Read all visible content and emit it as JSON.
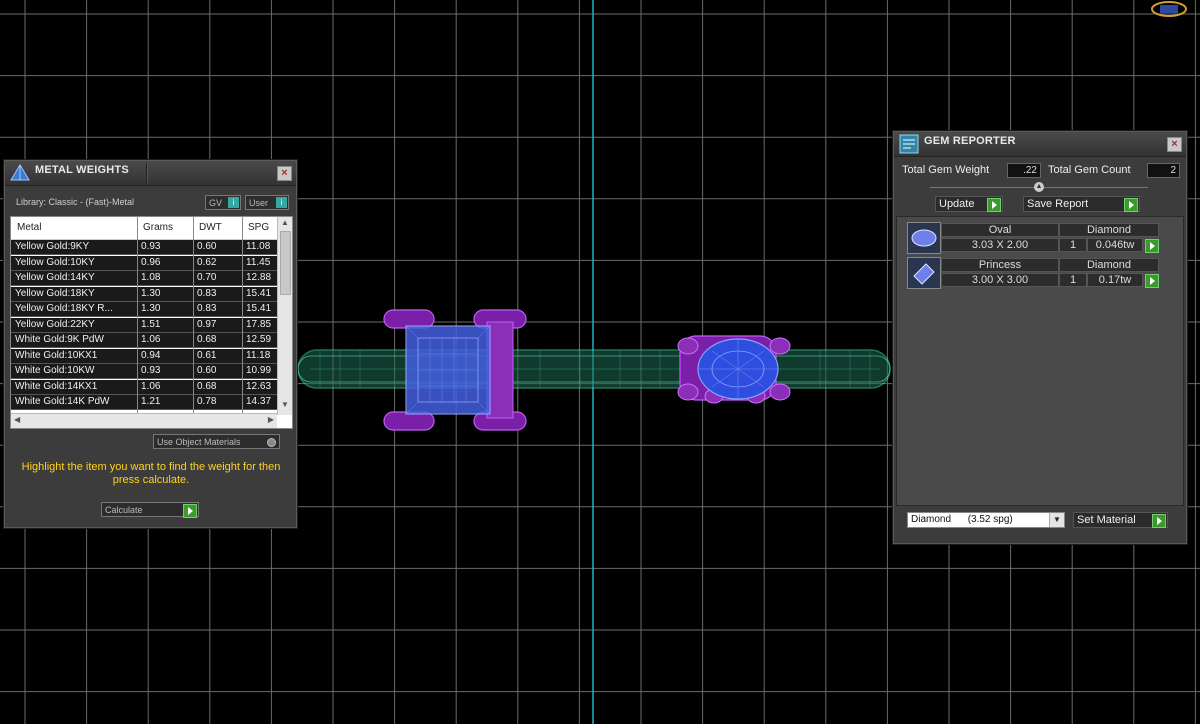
{
  "metal_weights": {
    "title": "METAL WEIGHTS",
    "library_label": "Library: Classic - (Fast)-Metal",
    "gv_label": "GV",
    "user_label": "User",
    "columns": [
      "Metal",
      "Grams",
      "DWT",
      "SPG"
    ],
    "rows": [
      {
        "metal": "Yellow Gold:9KY",
        "grams": "0.93",
        "dwt": "0.60",
        "spg": "11.08"
      },
      {
        "metal": "Yellow Gold:10KY",
        "grams": "0.96",
        "dwt": "0.62",
        "spg": "11.45"
      },
      {
        "metal": "Yellow Gold:14KY",
        "grams": "1.08",
        "dwt": "0.70",
        "spg": "12.88"
      },
      {
        "metal": "Yellow Gold:18KY",
        "grams": "1.30",
        "dwt": "0.83",
        "spg": "15.41"
      },
      {
        "metal": "Yellow Gold:18KY R...",
        "grams": "1.30",
        "dwt": "0.83",
        "spg": "15.41"
      },
      {
        "metal": "Yellow Gold:22KY",
        "grams": "1.51",
        "dwt": "0.97",
        "spg": "17.85"
      },
      {
        "metal": "White Gold:9K PdW",
        "grams": "1.06",
        "dwt": "0.68",
        "spg": "12.59"
      },
      {
        "metal": "White Gold:10KX1",
        "grams": "0.94",
        "dwt": "0.61",
        "spg": "11.18"
      },
      {
        "metal": "White Gold:10KW",
        "grams": "0.93",
        "dwt": "0.60",
        "spg": "10.99"
      },
      {
        "metal": "White Gold:14KX1",
        "grams": "1.06",
        "dwt": "0.68",
        "spg": "12.63"
      },
      {
        "metal": "White Gold:14K PdW",
        "grams": "1.21",
        "dwt": "0.78",
        "spg": "14.37"
      }
    ],
    "use_object_materials": "Use Object Materials",
    "instruction": "Highlight the item you want to find the weight for then press calculate.",
    "calculate_label": "Calculate"
  },
  "gem_reporter": {
    "title": "GEM REPORTER",
    "total_weight_label": "Total Gem Weight",
    "total_weight_value": ".22",
    "total_count_label": "Total Gem Count",
    "total_count_value": "2",
    "update_label": "Update",
    "save_report_label": "Save Report",
    "gems": [
      {
        "shape": "Oval",
        "material": "Diamond",
        "size": "3.03 X 2.00",
        "count": "1",
        "weight": "0.046tw"
      },
      {
        "shape": "Princess",
        "material": "Diamond",
        "size": "3.00 X 3.00",
        "count": "1",
        "weight": "0.17tw"
      }
    ],
    "material_select": "Diamond      (3.52 spg)",
    "set_material_label": "Set Material"
  },
  "colors": {
    "grid": "#8a8a8a",
    "axis": "#1fb3c4",
    "band": "#2f9f7f",
    "prong": "#a43fcf",
    "gem": "#4e72ff",
    "instruction_text": "#ffd21a"
  }
}
